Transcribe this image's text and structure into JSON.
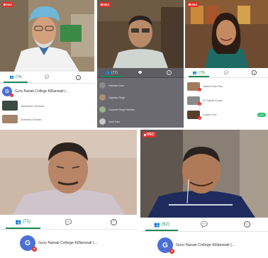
{
  "recording_label": "REC",
  "tiles": {
    "t1": {
      "participants_count": "(74)",
      "chat_badge": "",
      "rows": [
        {
          "avatar_letter": "G",
          "name": "Guru Nanak College Killianwali (...",
          "meta": ""
        },
        {
          "avatar_letter": "",
          "name": "Jaswinder Ghuman",
          "meta": "..."
        },
        {
          "avatar_letter": "",
          "name": "Sukhdev Sandhu",
          "meta": "..."
        }
      ]
    },
    "t2": {
      "participants_count": "(72)",
      "rows": [
        {
          "name": "Harinder Kaur"
        },
        {
          "name": "Jagdeep Singh"
        },
        {
          "name": "Gurpreet Singh Sandhu"
        },
        {
          "name": "Amrit Kaur"
        }
      ]
    },
    "t3": {
      "participants_count": "(73)",
      "rows": [
        {
          "name": "Jasleen Kaur Brar",
          "pill": ""
        },
        {
          "name": "Dr. Rajesh Kumar",
          "pill": ""
        },
        {
          "name": "Gurjeet Kaur",
          "pill": "Host"
        }
      ]
    },
    "t4": {
      "participants_count": "(71)",
      "chat_badge": "",
      "row": {
        "avatar_letter": "G",
        "name": "Guru Nanak College Killianwali (..."
      }
    },
    "t5": {
      "participants_count": "(62)",
      "chat_badge": "",
      "row": {
        "avatar_letter": "G",
        "name": "Guru Nanak College Killianwali (..."
      }
    }
  },
  "colors": {
    "accent": "#1f8a57",
    "rec": "#e0302c",
    "avatar": "#4b6fd6"
  },
  "icons": [
    "people-icon",
    "chat-icon",
    "info-icon"
  ]
}
